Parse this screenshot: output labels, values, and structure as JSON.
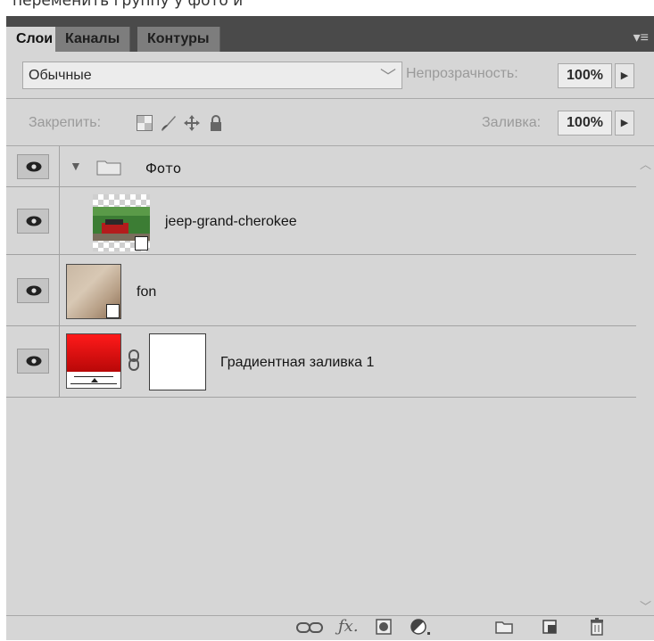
{
  "top_strip_text": "переменить группу у фото и",
  "tabs": [
    {
      "label": "Слои",
      "active": true
    },
    {
      "label": "Каналы",
      "active": false
    },
    {
      "label": "Контуры",
      "active": false
    }
  ],
  "panel_menu_icon": "panel-menu-icon",
  "blend_mode": {
    "value": "Обычные"
  },
  "opacity": {
    "label": "Непрозрачность:",
    "value": "100%"
  },
  "lock": {
    "label": "Закрепить:",
    "icons": [
      "lock-transparent-icon",
      "lock-image-icon",
      "lock-position-icon",
      "lock-all-icon"
    ]
  },
  "fill": {
    "label": "Заливка:",
    "value": "100%"
  },
  "layers": [
    {
      "name": "Фото",
      "type": "group",
      "visible": true,
      "expanded": true
    },
    {
      "name": "jeep-grand-cherokee",
      "type": "smart-object",
      "visible": true,
      "in_group": true
    },
    {
      "name": "fon",
      "type": "smart-object",
      "visible": true
    },
    {
      "name": "Градиентная заливка 1",
      "type": "gradient-fill",
      "visible": true
    }
  ],
  "bottom_icons": [
    "link-layers-icon",
    "fx-icon",
    "add-mask-icon",
    "adjustment-layer-icon",
    "new-group-icon",
    "new-layer-icon",
    "delete-layer-icon"
  ],
  "colors": {
    "panel_bg": "#d6d6d6",
    "frame": "#535353",
    "gradient_red": "#e21010"
  }
}
